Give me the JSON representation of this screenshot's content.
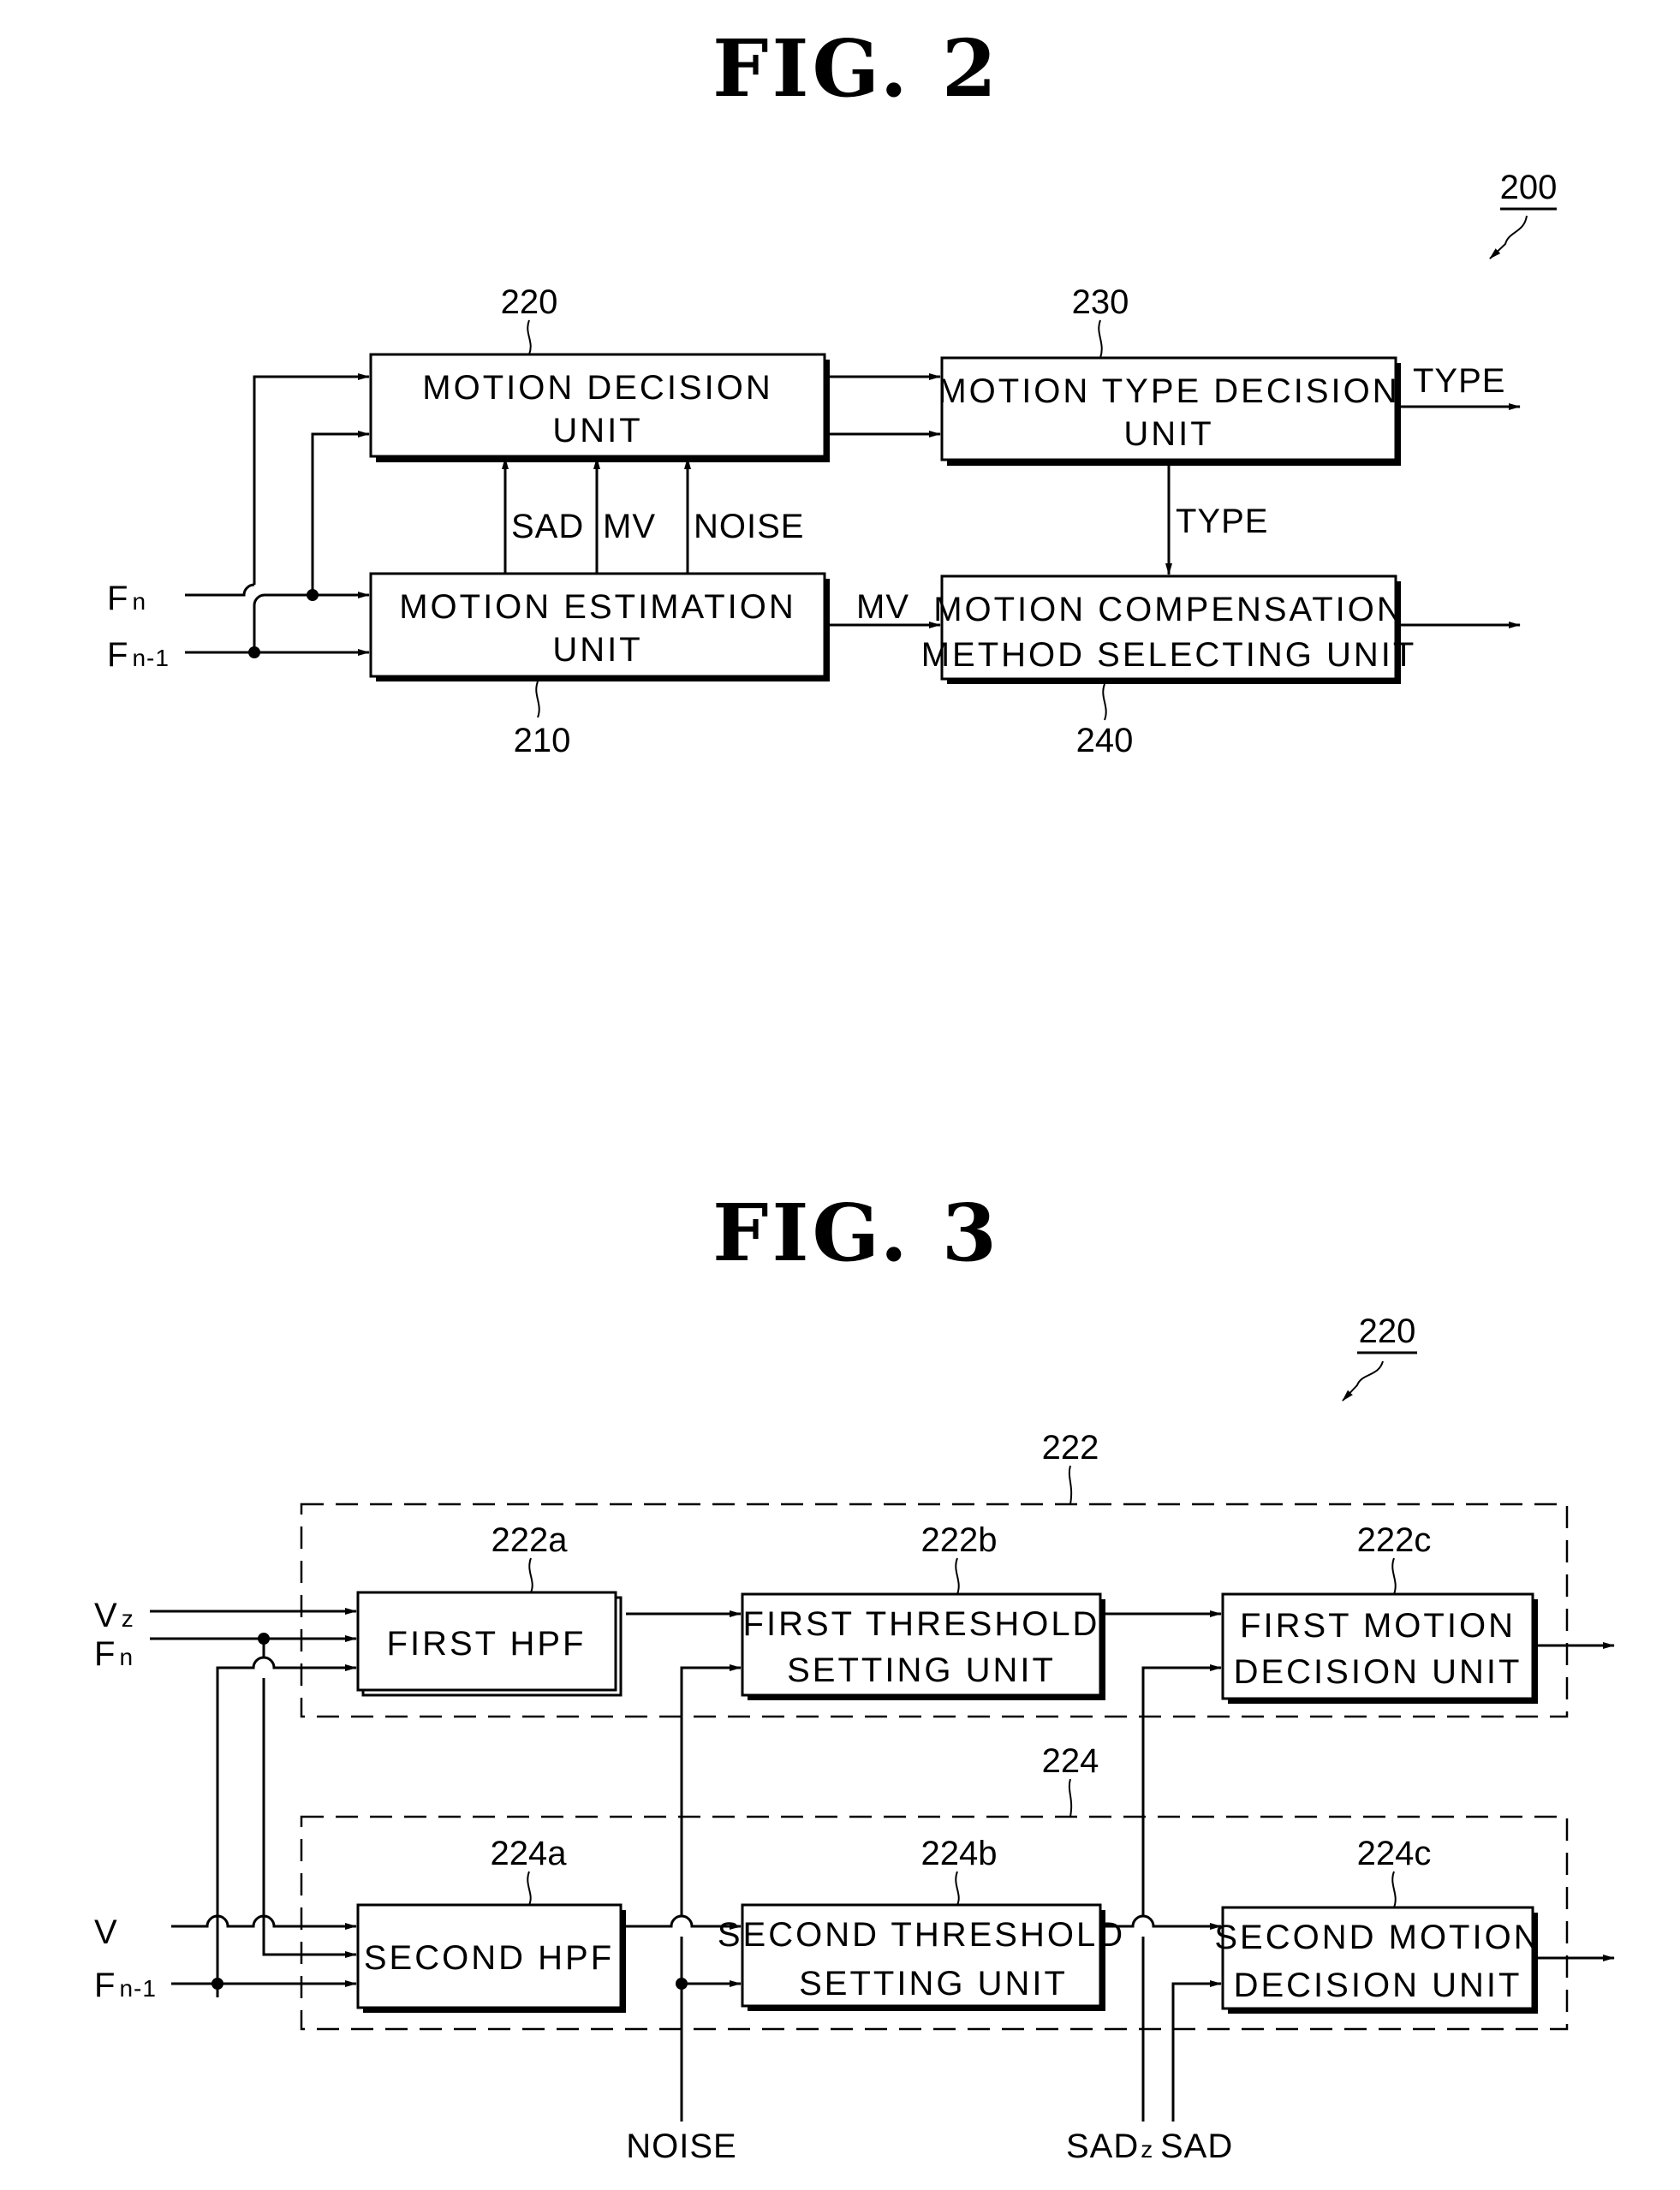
{
  "fig2": {
    "title": "FIG.  2",
    "ref_overall": "200",
    "blocks": {
      "motion_decision": {
        "ref": "220",
        "line1": "MOTION DECISION",
        "line2": "UNIT"
      },
      "motion_type_decision": {
        "ref": "230",
        "line1": "MOTION TYPE DECISION",
        "line2": "UNIT"
      },
      "motion_estimation": {
        "ref": "210",
        "line1": "MOTION ESTIMATION",
        "line2": "UNIT"
      },
      "motion_compensation": {
        "ref": "240",
        "line1": "MOTION COMPENSATION",
        "line2": "METHOD SELECTING UNIT"
      }
    },
    "inputs": {
      "fn": "F",
      "fn_sub": "n",
      "fn1": "F",
      "fn1_sub": "n-1"
    },
    "signals": {
      "sad": "SAD",
      "mv_up": "MV",
      "noise": "NOISE",
      "mv_right": "MV",
      "type_down": "TYPE",
      "type_out": "TYPE"
    }
  },
  "fig3": {
    "title": "FIG.  3",
    "ref_overall": "220",
    "groups": {
      "first": {
        "ref": "222"
      },
      "second": {
        "ref": "224"
      }
    },
    "blocks": {
      "first_hpf": {
        "ref": "222a",
        "line1": "FIRST HPF"
      },
      "first_threshold": {
        "ref": "222b",
        "line1": "FIRST THRESHOLD",
        "line2": "SETTING UNIT"
      },
      "first_motion": {
        "ref": "222c",
        "line1": "FIRST MOTION",
        "line2": "DECISION UNIT"
      },
      "second_hpf": {
        "ref": "224a",
        "line1": "SECOND HPF"
      },
      "second_threshold": {
        "ref": "224b",
        "line1": "SECOND THRESHOLD",
        "line2": "SETTING UNIT"
      },
      "second_motion": {
        "ref": "224c",
        "line1": "SECOND MOTION",
        "line2": "DECISION UNIT"
      }
    },
    "inputs": {
      "vz": "V",
      "vz_sub": "z",
      "fn": "F",
      "fn_sub": "n",
      "v": "V",
      "fn1": "F",
      "fn1_sub": "n-1"
    },
    "signals": {
      "noise": "NOISE",
      "sadz": "SAD",
      "sadz_sub": "z",
      "sad": "SAD"
    }
  }
}
